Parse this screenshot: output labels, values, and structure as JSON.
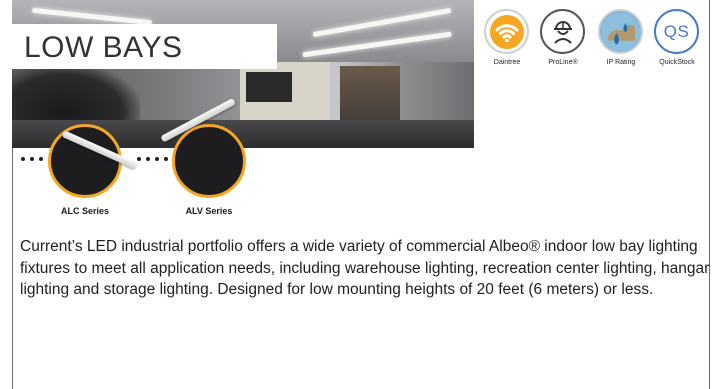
{
  "page": {
    "title": "LOW BAYS"
  },
  "products": [
    {
      "label": "ALC Series"
    },
    {
      "label": "ALV Series"
    }
  ],
  "badges": [
    {
      "label": "Daintree",
      "icon": "wifi-icon",
      "color": "#f5a623"
    },
    {
      "label": "ProLine®",
      "icon": "worker-icon",
      "color": "#333333"
    },
    {
      "label": "IP Rating",
      "icon": "water-drops-icon",
      "color": "#2a8ec9"
    },
    {
      "label": "QuickStock",
      "icon": "qs-icon",
      "text": "QS",
      "color": "#4a78c2"
    }
  ],
  "description": "Current’s LED industrial portfolio offers a wide variety of commercial Albeo® indoor low bay lighting fixtures to meet all application needs, including warehouse lighting, recreation center lighting, hangar lighting and storage lighting. Designed for low mounting heights of 20 feet (6 meters) or less.",
  "colors": {
    "accent": "#f5a623",
    "product_circle": "#1d1d1f",
    "text": "#1f1f1f",
    "border": "#6b6b6b"
  }
}
